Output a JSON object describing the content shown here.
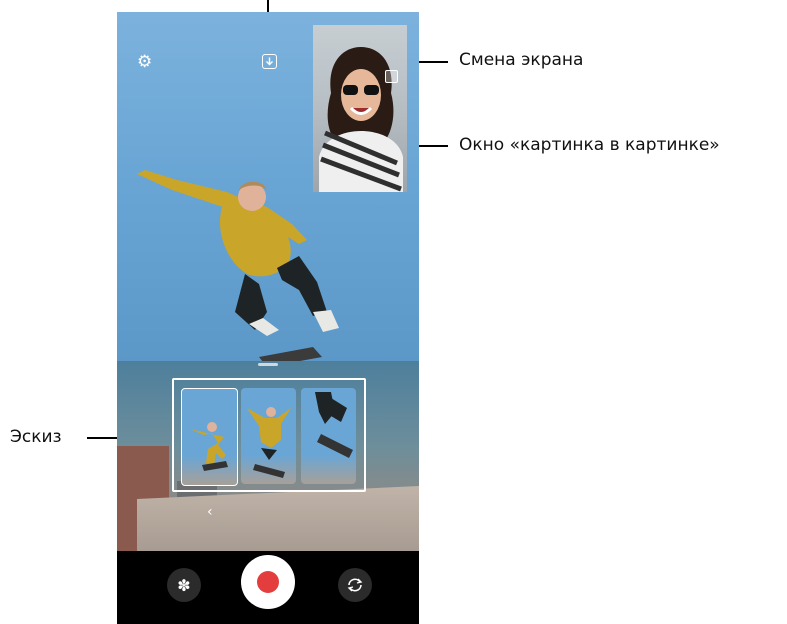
{
  "annotations": {
    "screen_switch": "Смена экрана",
    "pip_window": "Окно «картинка в картинке»",
    "thumbnail": "Эскиз"
  },
  "camera_ui": {
    "top_bar": {
      "settings_icon": "gear-icon",
      "save_icon": "download-icon"
    },
    "pip": {
      "swap_icon": "swap-screen-icon"
    },
    "bottom_bar": {
      "effect_icon": "flower-effect-icon",
      "record_icon": "record-button",
      "switch_icon": "switch-camera-icon"
    },
    "back_chevron": "‹"
  },
  "colors": {
    "record_red": "#e43d3d",
    "sky_blue": "#6aa6d5",
    "bottom_bar": "#000000"
  }
}
